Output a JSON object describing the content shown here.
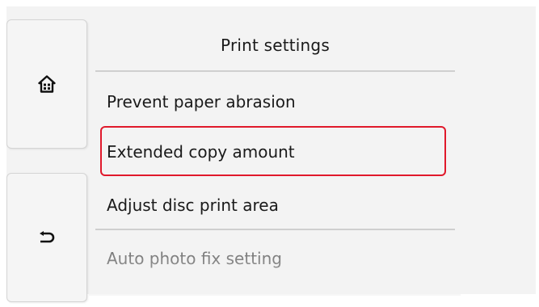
{
  "screen": {
    "title": "Print settings"
  },
  "sidebar": {
    "home": {
      "icon": "home-icon"
    },
    "back": {
      "icon": "back-arrow-icon"
    }
  },
  "menu": {
    "items": [
      {
        "label": "Prevent paper abrasion",
        "selected": false
      },
      {
        "label": "Extended copy amount",
        "selected": true
      },
      {
        "label": "Adjust disc print area",
        "selected": false
      },
      {
        "label": "Auto photo fix setting",
        "selected": false
      }
    ]
  },
  "colors": {
    "selection_outline": "#e0192b",
    "panel_background": "#f3f3f3"
  }
}
